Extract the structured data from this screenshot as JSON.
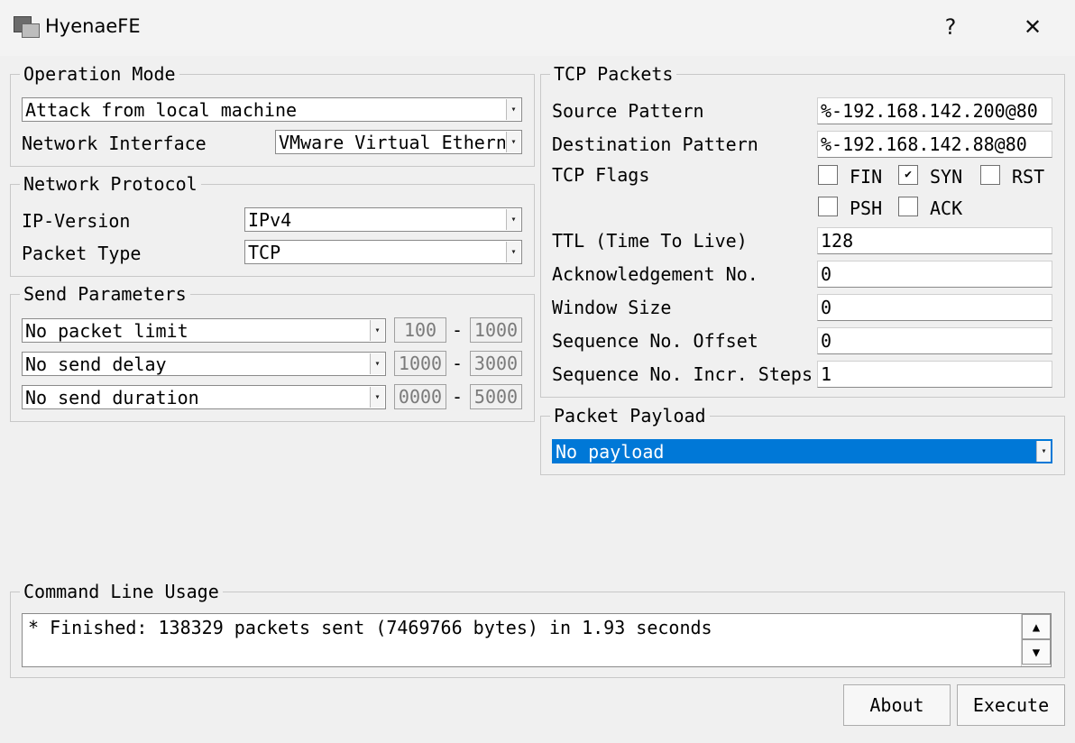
{
  "window": {
    "title": "HyenaeFE",
    "help_label": "?",
    "close_label": "✕",
    "icon": "app-icon"
  },
  "operation_mode": {
    "label": "Operation Mode",
    "mode_value": "Attack from local machine",
    "interface_label": "Network Interface",
    "interface_value": "VMware Virtual Ethern"
  },
  "network_protocol": {
    "label": "Network Protocol",
    "ip_version_label": "IP-Version",
    "ip_version_value": "IPv4",
    "packet_type_label": "Packet Type",
    "packet_type_value": "TCP"
  },
  "send_parameters": {
    "label": "Send Parameters",
    "rows": [
      {
        "value": "No packet limit",
        "min": "100",
        "max": "1000"
      },
      {
        "value": "No send delay",
        "min": "1000",
        "max": "3000"
      },
      {
        "value": "No send duration",
        "min": "0000",
        "max": "5000"
      }
    ],
    "separator": "-"
  },
  "tcp_packets": {
    "label": "TCP Packets",
    "source_label": "Source Pattern",
    "source_value": "%-192.168.142.200@80",
    "dest_label": "Destination Pattern",
    "dest_value": "%-192.168.142.88@80",
    "flags_label": "TCP Flags",
    "flags": [
      {
        "name": "FIN",
        "checked": false
      },
      {
        "name": "SYN",
        "checked": true
      },
      {
        "name": "RST",
        "checked": false
      },
      {
        "name": "PSH",
        "checked": false
      },
      {
        "name": "ACK",
        "checked": false
      }
    ],
    "ttl_label": "TTL (Time To Live)",
    "ttl_value": "128",
    "ack_label": "Acknowledgement No.",
    "ack_value": "0",
    "window_label": "Window Size",
    "window_value": "0",
    "seq_offset_label": "Sequence No. Offset",
    "seq_offset_value": "0",
    "seq_incr_label": "Sequence No. Incr. Steps",
    "seq_incr_value": "1"
  },
  "packet_payload": {
    "label": "Packet Payload",
    "value": "No payload"
  },
  "command_line": {
    "label": "Command Line Usage",
    "output": "* Finished: 138329 packets sent (7469766 bytes) in 1.93 seconds"
  },
  "buttons": {
    "about": "About",
    "execute": "Execute"
  }
}
